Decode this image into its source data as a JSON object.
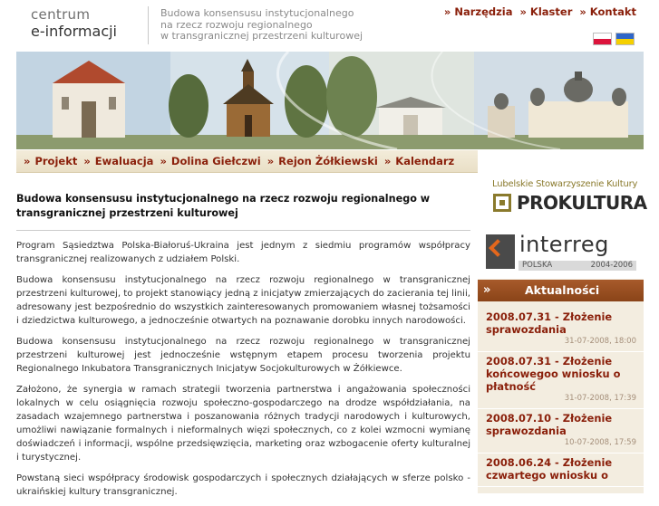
{
  "header": {
    "logo_line1": "centrum",
    "logo_line2": "e-informacji",
    "tagline_1": "Budowa konsensusu instytucjonalnego",
    "tagline_2": "na rzecz rozwoju regionalnego",
    "tagline_3": "w transgranicznej przestrzeni kulturowej",
    "topnav": [
      "» Narzędzia",
      "» Klaster",
      "» Kontakt"
    ],
    "flags": [
      "flag-pl-icon",
      "flag-ua-icon"
    ]
  },
  "mainnav": {
    "items": [
      "Projekt",
      "Ewaluacja",
      "Dolina Giełczwi",
      "Rejon Żółkiewski",
      "Kalendarz"
    ],
    "chevron": "»"
  },
  "content": {
    "title": "Budowa konsensusu instytucjonalnego na rzecz rozwoju regionalnego w transgranicznej przestrzeni kulturowej",
    "paragraphs": [
      "Program Sąsiedztwa Polska-Białoruś-Ukraina jest jednym z siedmiu programów współpracy transgranicznej realizowanych z udziałem Polski.",
      "Budowa konsensusu instytucjonalnego na rzecz rozwoju regionalnego w transgranicznej przestrzeni kulturowej, to projekt stanowiący jedną z inicjatyw zmierzających do zacierania tej linii, adresowany jest bezpośrednio do wszystkich zainteresowanych promowaniem własnej tożsamości i dziedzictwa kulturowego, a jednocześnie otwartych na poznawanie dorobku innych narodowości.",
      "Budowa konsensusu instytucjonalnego na rzecz rozwoju regionalnego w transgranicznej przestrzeni kulturowej jest jednocześnie wstępnym etapem procesu tworzenia projektu Regionalnego Inkubatora Transgranicznych Inicjatyw Socjokulturowych w Żółkiewce.",
      "Założono, że synergia w ramach strategii tworzenia partnerstwa i angażowania społeczności lokalnych w celu osiągnięcia rozwoju społeczno-gospodarczego na drodze współdziałania, na zasadach wzajemnego partnerstwa i poszanowania różnych tradycji narodowych i kulturowych, umożliwi nawiązanie formalnych i nieformalnych więzi społecznych, co z kolei wzmocni wymianę doświadczeń i informacji, wspólne przedsięwzięcia, marketing oraz wzbogacenie oferty kulturalnej i turystycznej.",
      "Powstaną sieci współpracy środowisk gospodarczych i społecznych działających w sferze polsko -ukraińskiej kultury transgranicznej."
    ]
  },
  "sidebar": {
    "prokultura_top": "Lubelskie Stowarzyszenie Kultury",
    "prokultura_word": "PROKULTURA",
    "interreg_word": "interreg",
    "interreg_country": "POLSKA",
    "interreg_years": "2004-2006",
    "news_heading": "Aktualności",
    "news_arrow": "»",
    "news": [
      {
        "title": "2008.07.31 - Złożenie sprawozdania",
        "date": "31-07-2008, 18:00"
      },
      {
        "title": "2008.07.31 - Złożenie końcowegoo wniosku o płatność",
        "date": "31-07-2008, 17:39"
      },
      {
        "title": "2008.07.10 - Złożenie sprawozdania",
        "date": "10-07-2008, 17:59"
      },
      {
        "title": "2008.06.24 - Złożenie czwartego wniosku o",
        "date": ""
      }
    ]
  },
  "colors": {
    "link": "#8a1f0a",
    "nav_bg": "#efe6d1",
    "news_head": "#9a4f22",
    "sidebar_bg": "#f3ede0"
  }
}
